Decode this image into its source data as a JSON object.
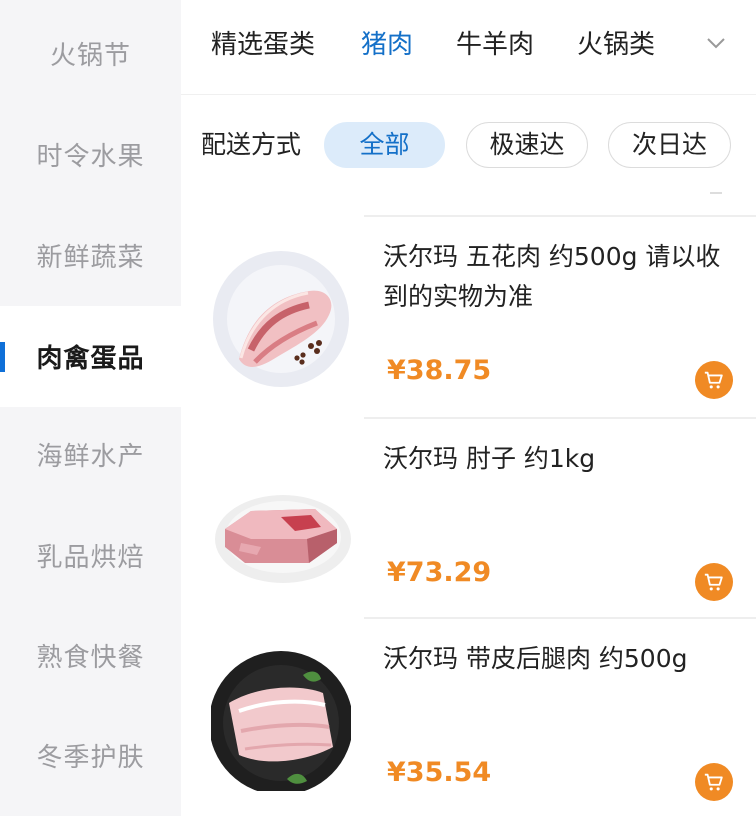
{
  "sidebar": {
    "items": [
      {
        "label": "火锅节",
        "active": false
      },
      {
        "label": "时令水果",
        "active": false
      },
      {
        "label": "新鲜蔬菜",
        "active": false
      },
      {
        "label": "肉禽蛋品",
        "active": true
      },
      {
        "label": "海鲜水产",
        "active": false
      },
      {
        "label": "乳品烘焙",
        "active": false
      },
      {
        "label": "熟食快餐",
        "active": false
      },
      {
        "label": "冬季护肤",
        "active": false
      }
    ]
  },
  "tabs": {
    "items": [
      {
        "label": "精选蛋类",
        "active": false
      },
      {
        "label": "猪肉",
        "active": true
      },
      {
        "label": "牛羊肉",
        "active": false
      },
      {
        "label": "火锅类",
        "active": false
      }
    ],
    "more_icon": "chevron-down-icon"
  },
  "filter": {
    "label": "配送方式",
    "options": [
      {
        "label": "全部",
        "active": true
      },
      {
        "label": "极速达",
        "active": false
      },
      {
        "label": "次日达",
        "active": false
      }
    ]
  },
  "products": [
    {
      "name": "沃尔玛 五花肉 约500g 请以收到的实物为准",
      "price": "¥38.75",
      "image": "pork-belly-on-plate",
      "cart_icon": "cart-icon"
    },
    {
      "name": "沃尔玛 肘子 约1kg",
      "price": "¥73.29",
      "image": "pork-hock-on-plate",
      "cart_icon": "cart-icon"
    },
    {
      "name": "沃尔玛 带皮后腿肉 约500g",
      "price": "¥35.54",
      "image": "pork-leg-on-dark-plate",
      "cart_icon": "cart-icon"
    }
  ],
  "colors": {
    "accent_blue": "#1470c8",
    "price_orange": "#f08a24",
    "sidebar_bg": "#f5f5f7",
    "chip_active_bg": "#dcebfa"
  }
}
